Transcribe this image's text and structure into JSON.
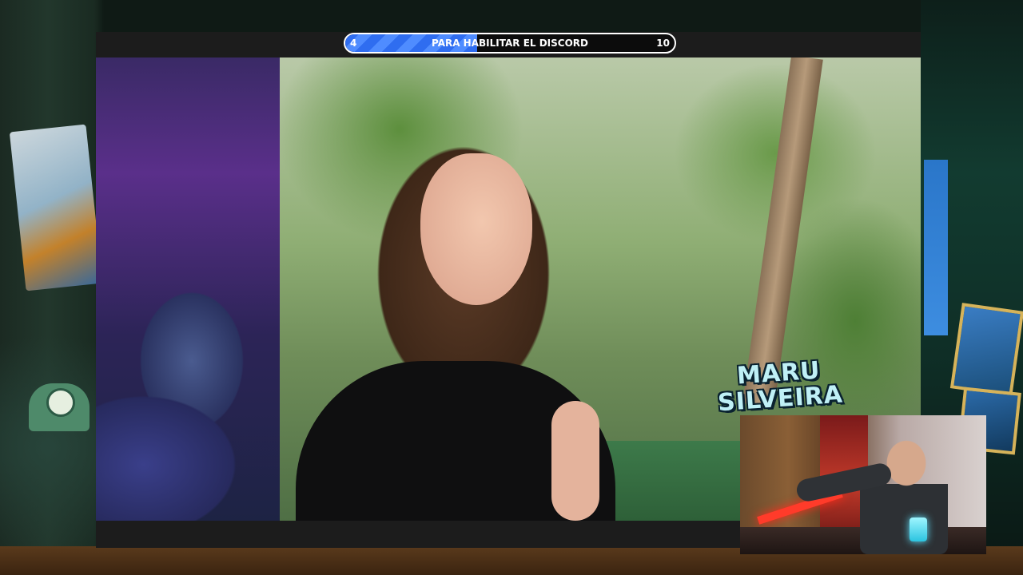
{
  "goal_bar": {
    "current": "4",
    "label": "PARA HABILITAR EL DISCORD",
    "target": "10",
    "progress_fraction": 0.4,
    "fill_color": "#2f6df0",
    "border_color": "#ffffff"
  },
  "guest_name_tag": {
    "line1": "MARU",
    "line2": "SILVEIRA",
    "text_color": "#bff0f6",
    "outline_color": "#0a2230"
  },
  "colors": {
    "video_frame": "#151515",
    "background": "#0e1a14"
  }
}
